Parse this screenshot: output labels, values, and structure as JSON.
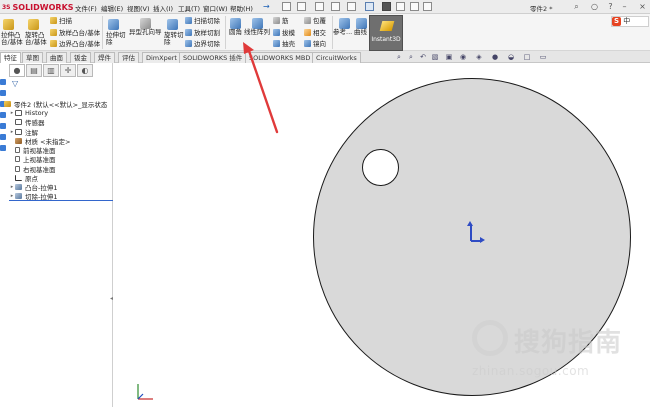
{
  "app": {
    "logo_text": "SOLIDWORKS",
    "logo_prefix": "3S",
    "document_title": "零件2 *"
  },
  "menu": [
    "文件(F)",
    "编辑(E)",
    "视图(V)",
    "插入(I)",
    "工具(T)",
    "窗口(W)",
    "帮助(H)"
  ],
  "ribbon": {
    "extrude_boss": "拉伸凸\n台/基体",
    "revolve_boss": "旋转凸\n台/基体",
    "sweep": "扫描",
    "loft": "放样凸台/基体",
    "boundary": "边界凸台/基体",
    "extrude_cut": "拉伸切\n除",
    "hole_wizard": "异型孔向导",
    "revolve_cut": "旋转切\n除",
    "sweep_cut": "扫描切除",
    "loft_cut": "放样切割",
    "boundary_cut": "边界切除",
    "fillet": "圆角",
    "linear_pattern": "线性阵列",
    "rib": "筋",
    "draft": "拔模",
    "shell": "抽壳",
    "wrap": "包覆",
    "intersect": "相交",
    "mirror": "镜向",
    "reference": "参考...",
    "curves": "曲线",
    "instant3d": "Instant3D"
  },
  "tabs": [
    "特征",
    "草图",
    "曲面",
    "钣金",
    "焊件",
    "评估",
    "DimXpert",
    "SOLIDWORKS 插件",
    "SOLIDWORKS MBD",
    "CircuitWorks"
  ],
  "active_tab": "特征",
  "tree": {
    "root": "零件2 (默认<<默认>_显示状态",
    "items": [
      {
        "label": "History",
        "icon": "history-icon"
      },
      {
        "label": "传感器",
        "icon": "sensor-icon"
      },
      {
        "label": "注解",
        "icon": "annotation-icon"
      },
      {
        "label": "材质 <未指定>",
        "icon": "material-icon"
      },
      {
        "label": "前视基准面",
        "icon": "plane-icon"
      },
      {
        "label": "上视基准面",
        "icon": "plane-icon"
      },
      {
        "label": "右视基准面",
        "icon": "plane-icon"
      },
      {
        "label": "原点",
        "icon": "origin-icon"
      },
      {
        "label": "凸台-拉伸1",
        "icon": "extrude-icon"
      },
      {
        "label": "切除-拉伸1",
        "icon": "cut-extrude-icon"
      }
    ]
  },
  "ime": {
    "mark": "S",
    "lang": "中"
  },
  "watermark": {
    "text": "搜狗指南",
    "url": "zhinan.sogou.com"
  },
  "colors": {
    "brand": "#c8102e",
    "part_face": "#d9d9d9",
    "origin": "#2f4cc4",
    "annotation_arrow": "#e03a3a"
  }
}
